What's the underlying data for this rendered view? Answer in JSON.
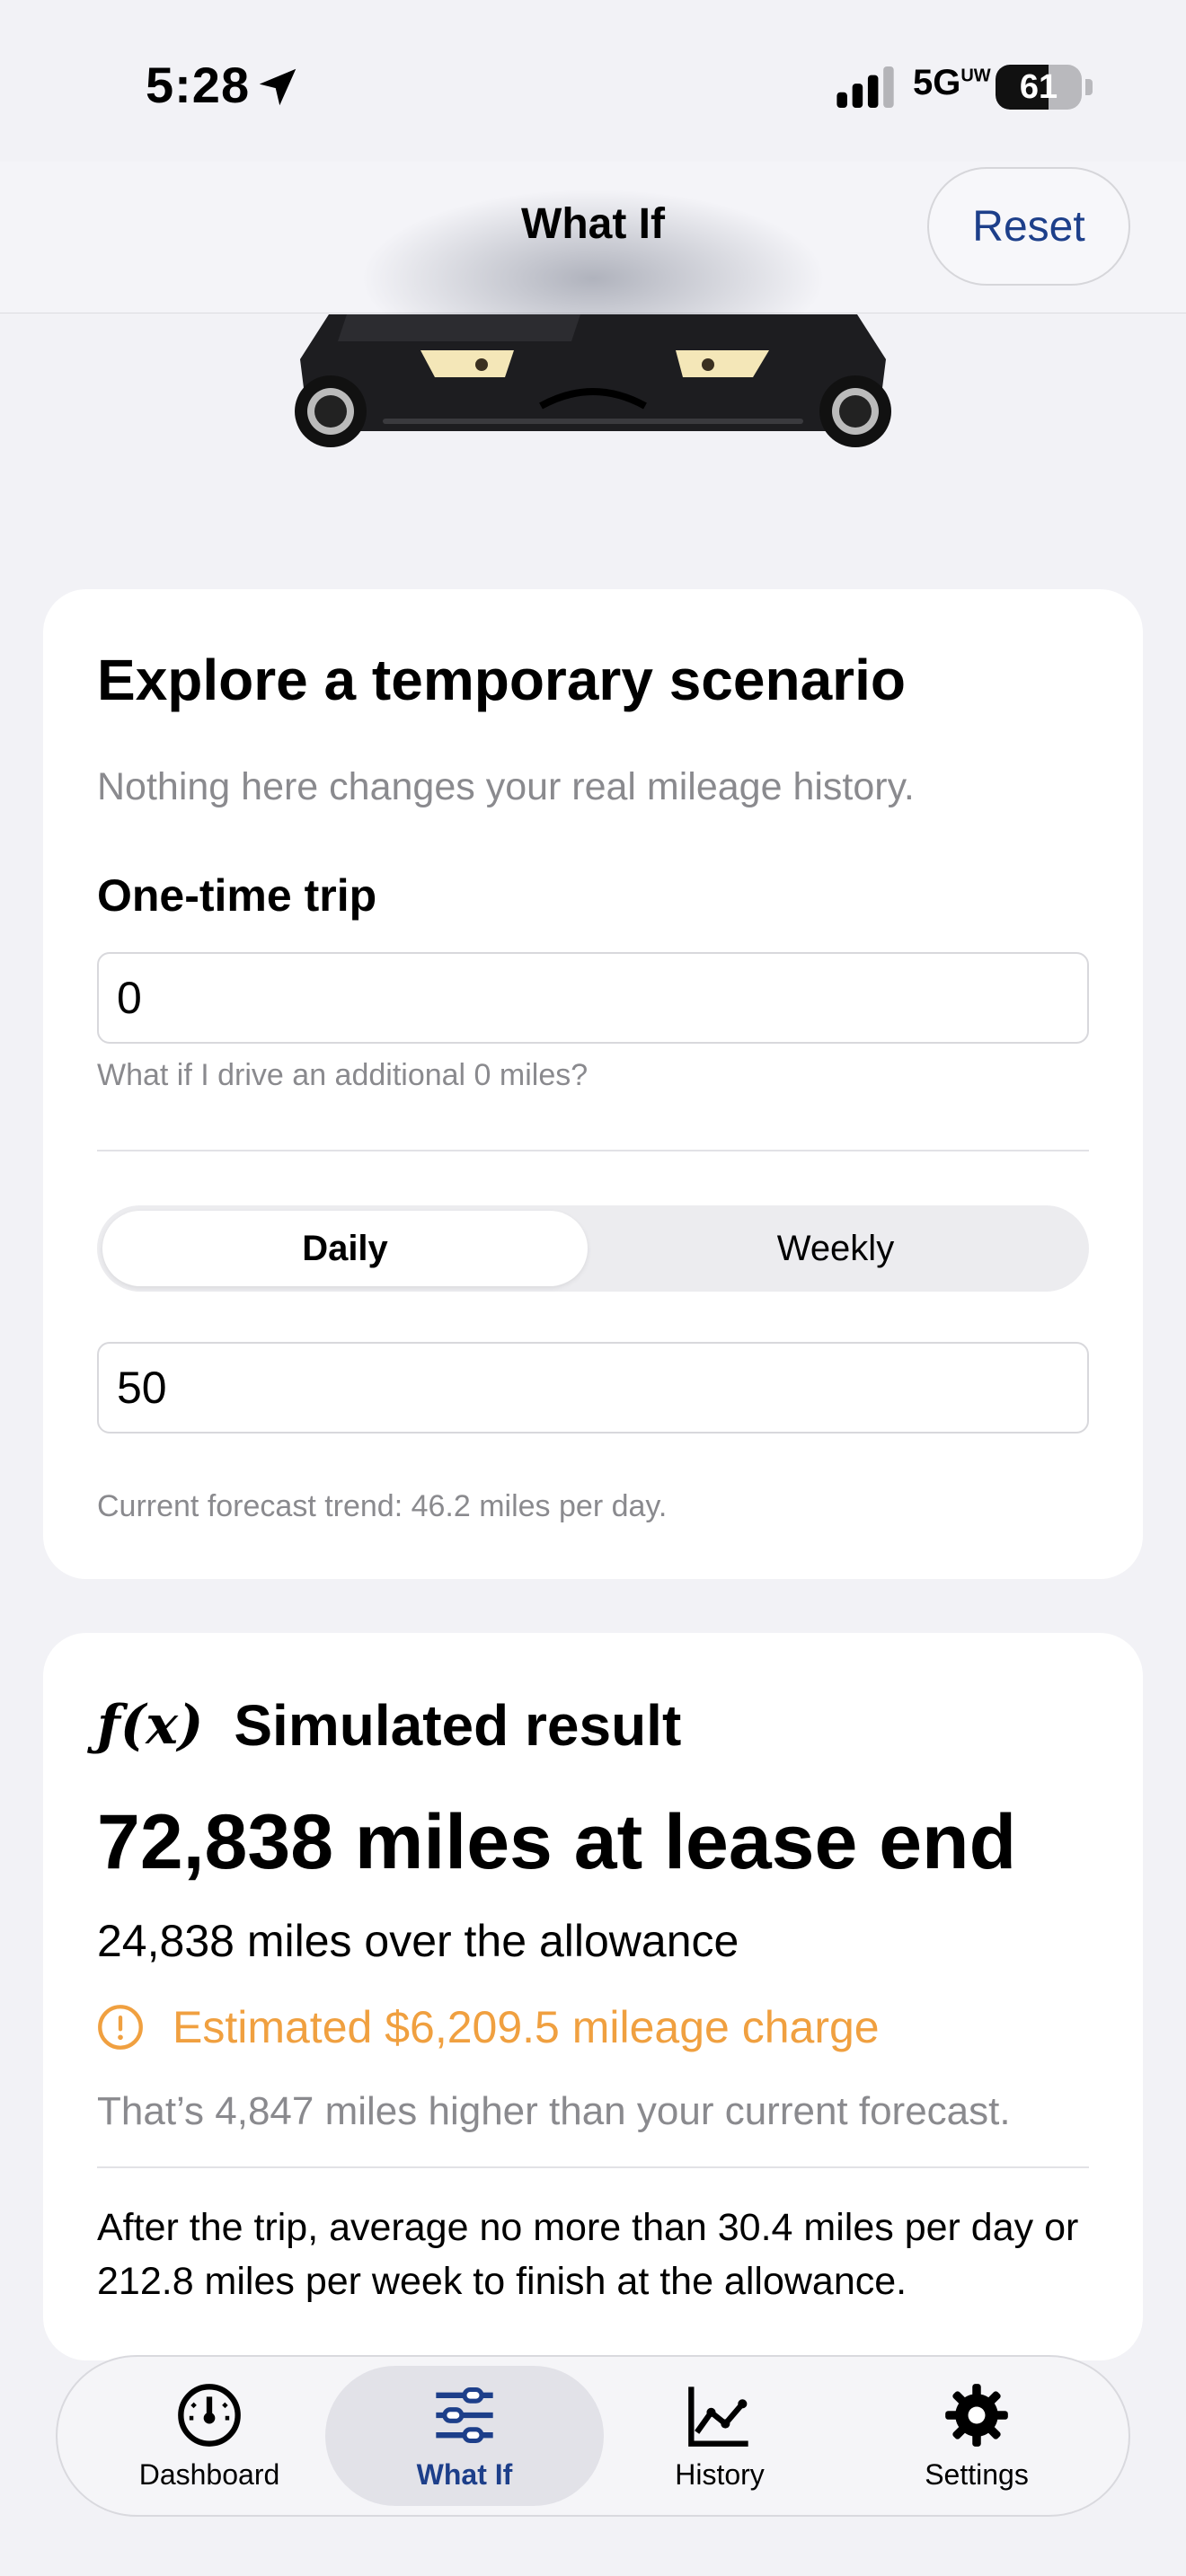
{
  "status_bar": {
    "time": "5:28",
    "network": "5G",
    "network_suffix": "UW",
    "battery": "61",
    "battery_level": 0.61
  },
  "header": {
    "title": "What If",
    "reset_label": "Reset"
  },
  "scenario": {
    "title": "Explore a temporary scenario",
    "subtitle": "Nothing here changes your real mileage history.",
    "trip_label": "One-time trip",
    "trip_value": "0",
    "trip_hint": "What if I drive an additional 0 miles?",
    "segments": [
      "Daily",
      "Weekly"
    ],
    "selected_segment": "Daily",
    "rate_value": "50",
    "forecast_hint": "Current forecast trend: 46.2 miles per day."
  },
  "result": {
    "icon_label": "ƒ(x)",
    "title": "Simulated result",
    "headline": "72,838 miles at lease end",
    "over_allowance": "24,838 miles over the allowance",
    "charge": "Estimated $6,209.5 mileage charge",
    "comparison": "That’s 4,847 miles higher than your current forecast.",
    "advice": "After the trip, average no more than 30.4 miles per day or 212.8 miles per week to finish at the allowance."
  },
  "tabs": [
    {
      "label": "Dashboard",
      "icon": "speedometer-icon"
    },
    {
      "label": "What If",
      "icon": "sliders-icon"
    },
    {
      "label": "History",
      "icon": "line-chart-icon"
    },
    {
      "label": "Settings",
      "icon": "gear-icon"
    }
  ],
  "colors": {
    "accent": "#1d3f8a",
    "warning": "#f0a040",
    "muted": "#8a8a8e",
    "background": "#f2f2f6"
  }
}
